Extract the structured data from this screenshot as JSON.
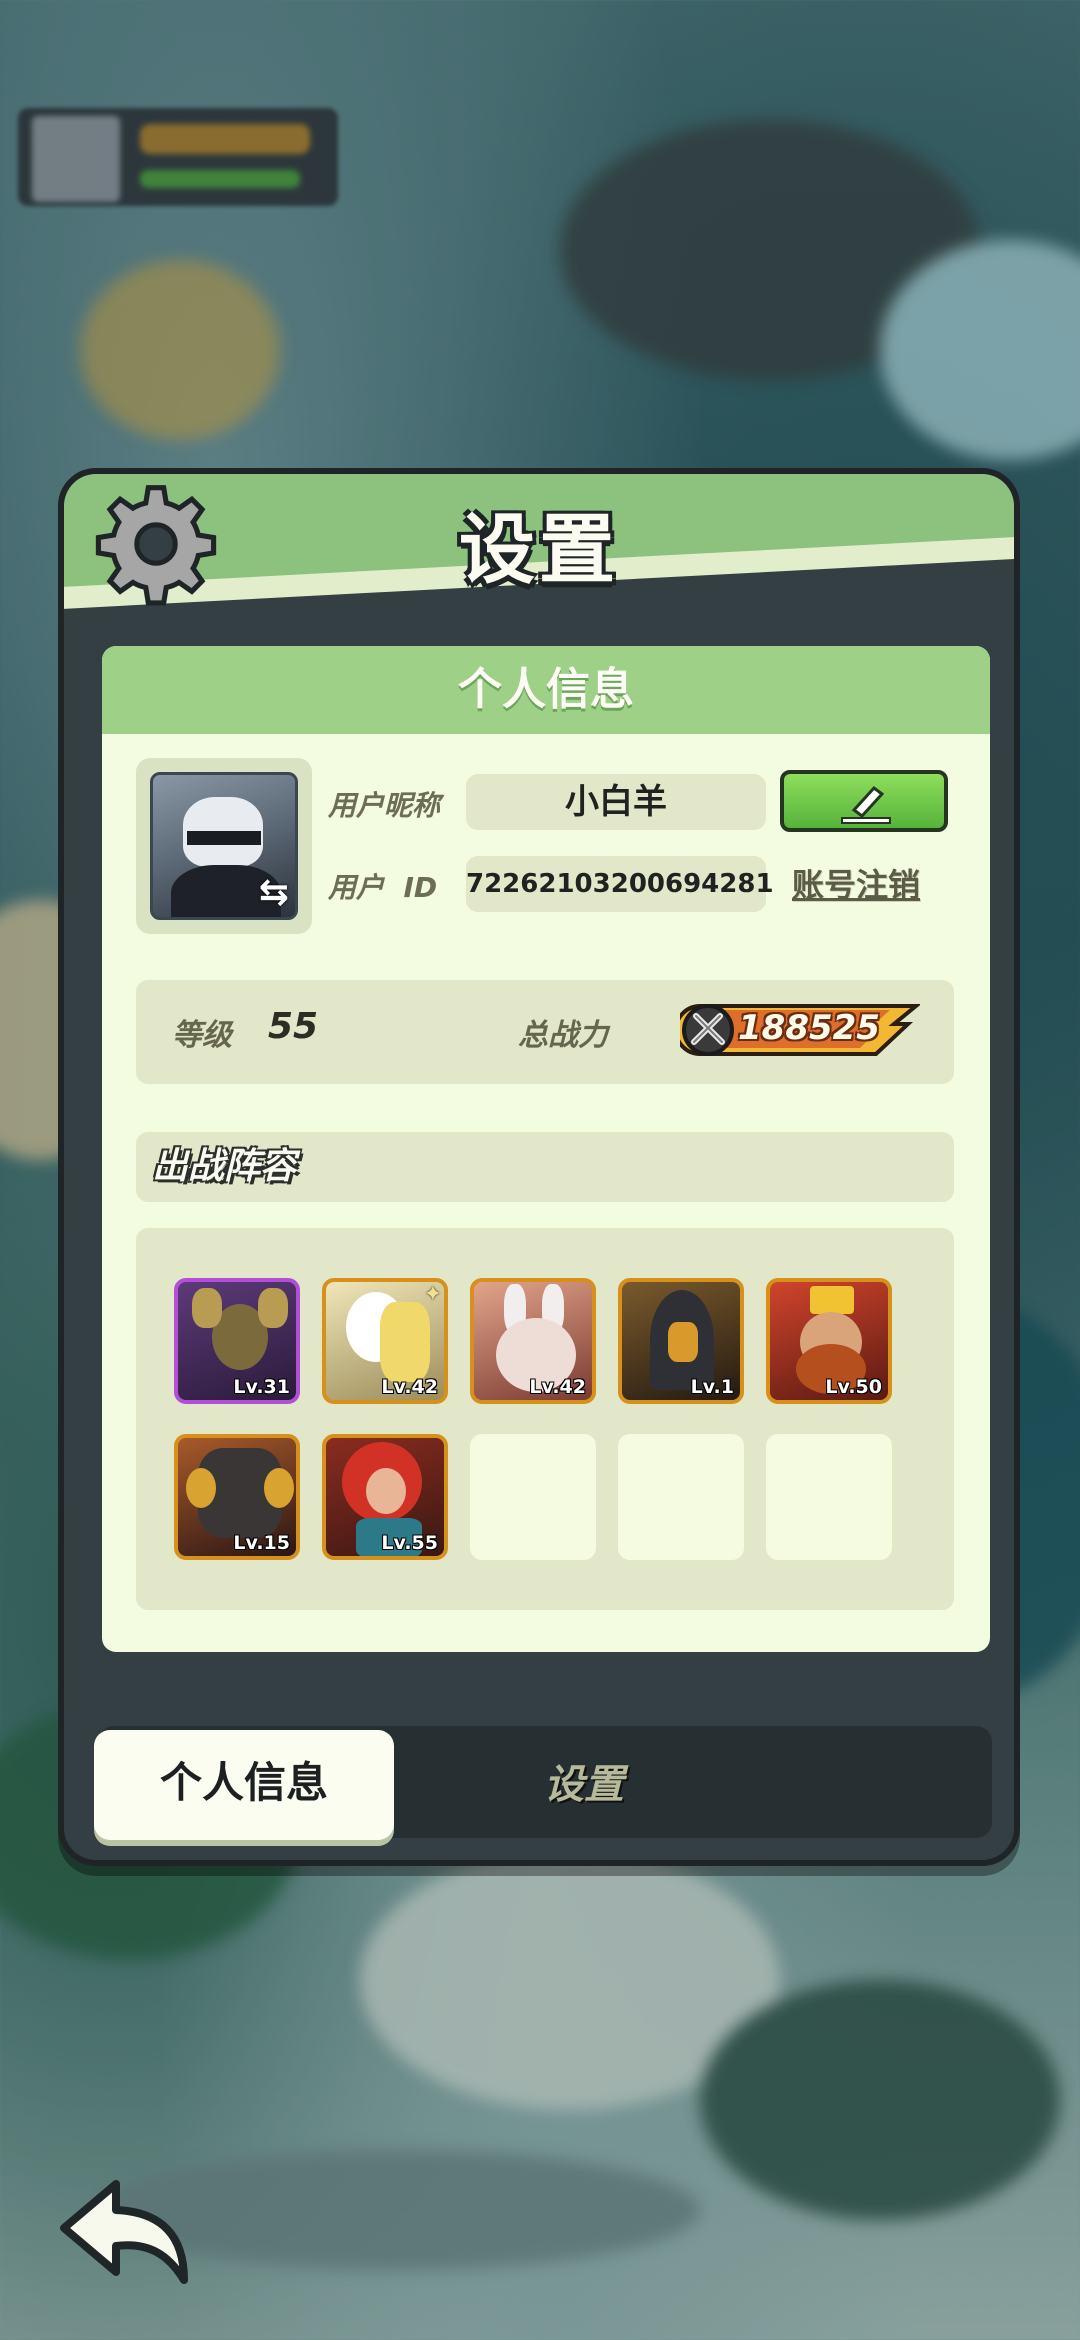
{
  "dialog": {
    "title": "设置",
    "section_title": "个人信息"
  },
  "profile": {
    "nickname_label": "用户昵称",
    "nickname": "小白羊",
    "id_label": "用户  ID",
    "user_id": "72262103200694281",
    "cancel_account": "账号注销"
  },
  "stats": {
    "level_label": "等级",
    "level": "55",
    "power_label": "总战力",
    "power": "188525"
  },
  "team": {
    "title": "出战阵容",
    "heroes": [
      {
        "level": "Lv.31",
        "frame": "purple"
      },
      {
        "level": "Lv.42",
        "frame": "gold"
      },
      {
        "level": "Lv.42",
        "frame": "gold"
      },
      {
        "level": "Lv.1",
        "frame": "gold"
      },
      {
        "level": "Lv.50",
        "frame": "gold"
      },
      {
        "level": "Lv.15",
        "frame": "gold"
      },
      {
        "level": "Lv.55",
        "frame": "gold"
      }
    ]
  },
  "tabs": {
    "profile": "个人信息",
    "settings": "设置"
  },
  "colors": {
    "header_green": "#8cc27e",
    "card_bg": "#f3fbe0",
    "edit_green": "#56b33a",
    "gold_frame": "#d6901c",
    "purple_frame": "#b24fd8"
  },
  "icons": [
    "gear-icon",
    "swap-icon",
    "edit-icon",
    "power-icon",
    "back-arrow-icon"
  ]
}
